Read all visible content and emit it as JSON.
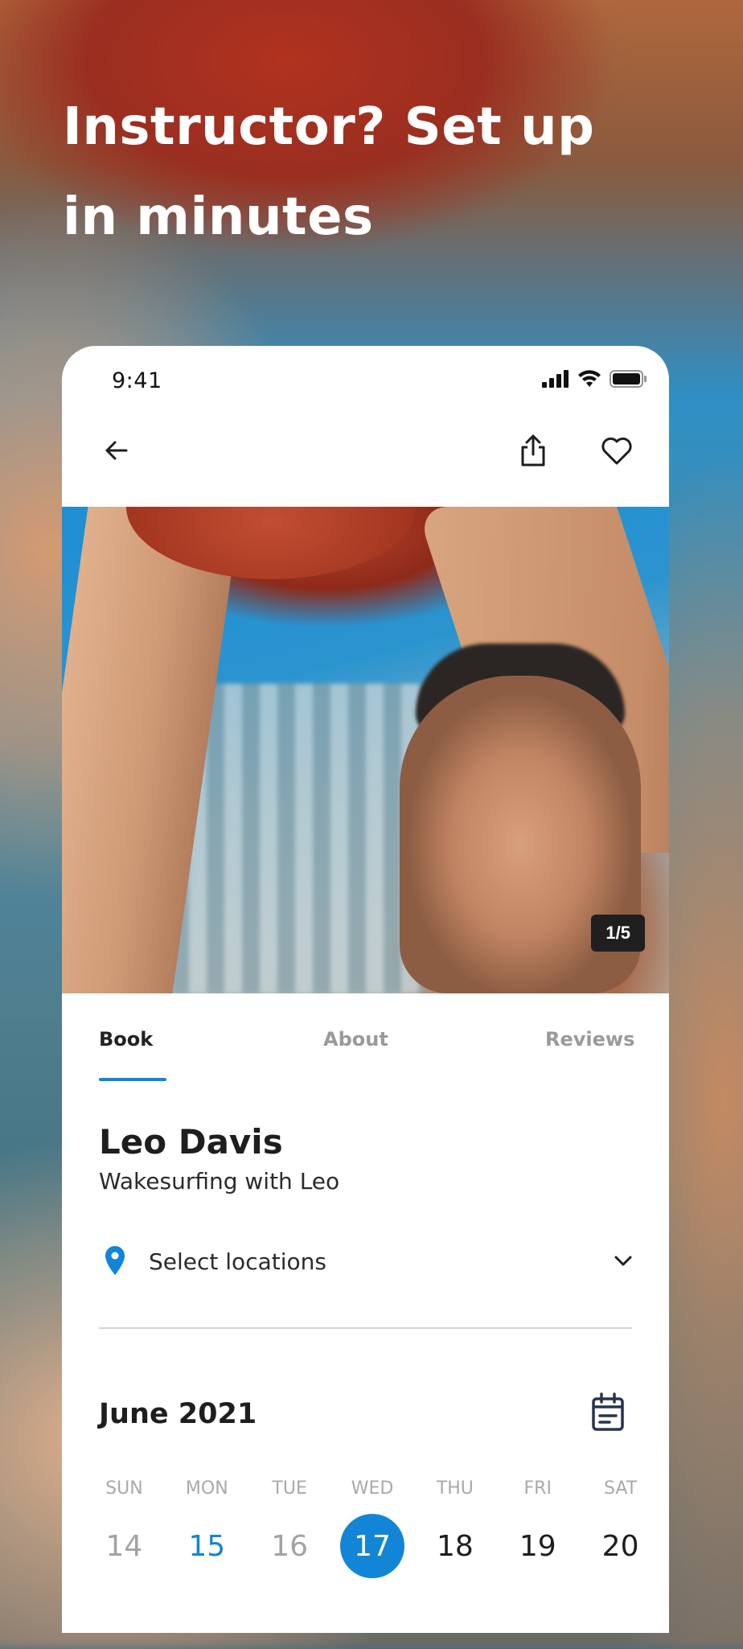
{
  "headline": {
    "line1": "Instructor? Set up",
    "line2": "in minutes"
  },
  "status_bar": {
    "time": "9:41"
  },
  "nav": {
    "back_icon": "arrow-left-icon",
    "share_icon": "share-icon",
    "favorite_icon": "heart-icon"
  },
  "gallery": {
    "counter": "1/5"
  },
  "tabs": [
    "Book",
    "About",
    "Reviews"
  ],
  "active_tab": "Book",
  "profile": {
    "name": "Leo Davis",
    "subtitle": "Wakesurfing with Leo"
  },
  "location": {
    "label": "Select locations",
    "icon": "map-pin-icon",
    "chevron": "chevron-down-icon"
  },
  "calendar": {
    "month": "June 2021",
    "weekdays": [
      "SUN",
      "MON",
      "TUE",
      "WED",
      "THU",
      "FRI",
      "SAT"
    ],
    "days": [
      "14",
      "15",
      "16",
      "17",
      "18",
      "19",
      "20"
    ],
    "today": "15",
    "selected": "17"
  },
  "colors": {
    "accent": "#1285d6",
    "text": "#1e1e1e",
    "muted": "#a3a3a3"
  }
}
